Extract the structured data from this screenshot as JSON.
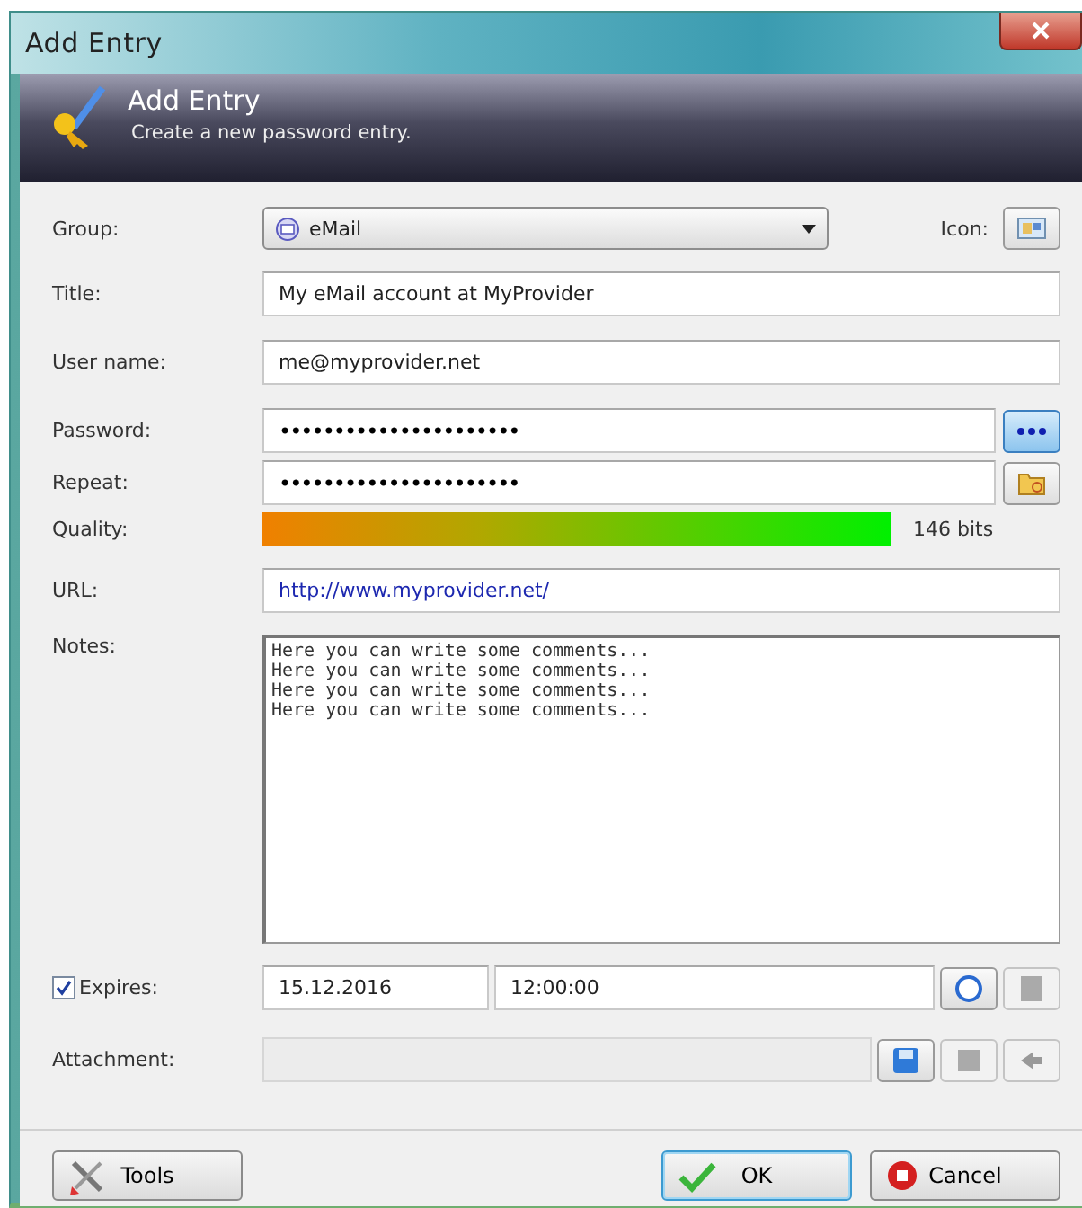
{
  "window": {
    "title": "Add Entry"
  },
  "header": {
    "title": "Add Entry",
    "subtitle": "Create a new password entry."
  },
  "group": {
    "label": "Group:",
    "value": "eMail"
  },
  "icon_label": "Icon:",
  "title": {
    "label": "Title:",
    "value": "My eMail account at MyProvider"
  },
  "user_name": {
    "label": "User name:",
    "value": "me@myprovider.net"
  },
  "password": {
    "label": "Password:",
    "value": "••••••••••••••••••••••"
  },
  "repeat": {
    "label": "Repeat:",
    "value": "••••••••••••••••••••••"
  },
  "quality": {
    "label": "Quality:",
    "reading": "146 bits"
  },
  "url": {
    "label": "URL:",
    "value": "http://www.myprovider.net/"
  },
  "notes": {
    "label": "Notes:",
    "lines": [
      "Here you can write some comments...",
      "Here you can write some comments...",
      "Here you can write some comments...",
      "Here you can write some comments..."
    ]
  },
  "expires": {
    "label": "Expires:",
    "checked": true,
    "date": "15.12.2016",
    "time": "12:00:00"
  },
  "attachment": {
    "label": "Attachment:"
  },
  "buttons": [
    {
      "label": "Tools",
      "kind": "tools"
    },
    {
      "label": "OK",
      "kind": "ok"
    },
    {
      "label": "Cancel",
      "kind": "cancel"
    }
  ]
}
